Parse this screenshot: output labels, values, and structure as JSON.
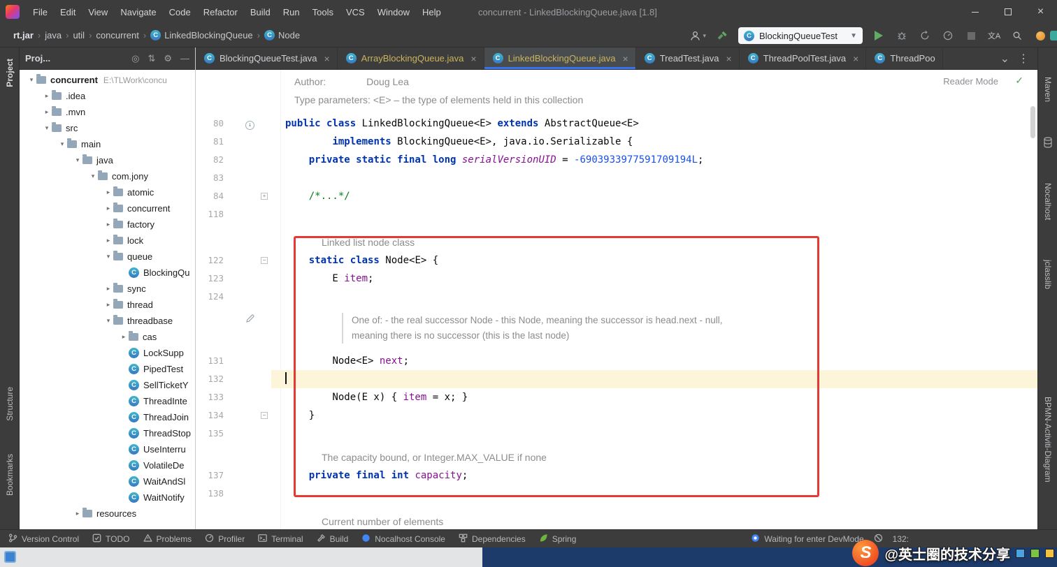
{
  "colors": {
    "accent_blue": "#3574f0",
    "annotation_red": "#e53935",
    "keyword_blue": "#0033b3",
    "field_purple": "#871094",
    "number_blue": "#1750eb",
    "watermark_orange": "#f04e23"
  },
  "window": {
    "title": "concurrent - LinkedBlockingQueue.java [1.8]"
  },
  "menu": [
    "File",
    "Edit",
    "View",
    "Navigate",
    "Code",
    "Refactor",
    "Build",
    "Run",
    "Tools",
    "VCS",
    "Window",
    "Help"
  ],
  "breadcrumbs": [
    {
      "label": "rt.jar"
    },
    {
      "label": "java"
    },
    {
      "label": "util"
    },
    {
      "label": "concurrent"
    },
    {
      "label": "LinkedBlockingQueue",
      "icon": "class"
    },
    {
      "label": "Node",
      "icon": "class"
    }
  ],
  "run_widget": {
    "config_name": "BlockingQueueTest"
  },
  "tabs": [
    {
      "label": "BlockingQueueTest.java",
      "lib": false,
      "active": false,
      "close": true
    },
    {
      "label": "ArrayBlockingQueue.java",
      "lib": true,
      "active": false,
      "close": true
    },
    {
      "label": "LinkedBlockingQueue.java",
      "lib": true,
      "active": true,
      "close": true
    },
    {
      "label": "TreadTest.java",
      "lib": false,
      "active": false,
      "close": true
    },
    {
      "label": "ThreadPoolTest.java",
      "lib": false,
      "active": false,
      "close": true
    },
    {
      "label": "ThreadPoo",
      "lib": false,
      "active": false,
      "close": false
    }
  ],
  "left_toolwindows": [
    "Project",
    "Structure",
    "Bookmarks"
  ],
  "right_toolwindows": [
    "Maven",
    "Nocalhost",
    "jclasslib",
    "BPMN-Activiti-Diagram"
  ],
  "project": {
    "header": "Proj..."
  },
  "tree": [
    {
      "label": "concurrent",
      "indent": 0,
      "chev": "v",
      "icon": "folder",
      "bold": true,
      "extra": "E:\\TLWork\\concu"
    },
    {
      "label": ".idea",
      "indent": 1,
      "chev": ">",
      "icon": "folder"
    },
    {
      "label": ".mvn",
      "indent": 1,
      "chev": ">",
      "icon": "folder"
    },
    {
      "label": "src",
      "indent": 1,
      "chev": "v",
      "icon": "folder"
    },
    {
      "label": "main",
      "indent": 2,
      "chev": "v",
      "icon": "folder"
    },
    {
      "label": "java",
      "indent": 3,
      "chev": "v",
      "icon": "folder"
    },
    {
      "label": "com.jony",
      "indent": 4,
      "chev": "v",
      "icon": "folder"
    },
    {
      "label": "atomic",
      "indent": 5,
      "chev": ">",
      "icon": "folder"
    },
    {
      "label": "concurrent",
      "indent": 5,
      "chev": ">",
      "icon": "folder"
    },
    {
      "label": "factory",
      "indent": 5,
      "chev": ">",
      "icon": "folder"
    },
    {
      "label": "lock",
      "indent": 5,
      "chev": ">",
      "icon": "folder"
    },
    {
      "label": "queue",
      "indent": 5,
      "chev": "v",
      "icon": "folder"
    },
    {
      "label": "BlockingQu",
      "indent": 6,
      "chev": "",
      "icon": "class"
    },
    {
      "label": "sync",
      "indent": 5,
      "chev": ">",
      "icon": "folder"
    },
    {
      "label": "thread",
      "indent": 5,
      "chev": ">",
      "icon": "folder"
    },
    {
      "label": "threadbase",
      "indent": 5,
      "chev": "v",
      "icon": "folder"
    },
    {
      "label": "cas",
      "indent": 6,
      "chev": ">",
      "icon": "folder"
    },
    {
      "label": "LockSupp",
      "indent": 6,
      "chev": "",
      "icon": "class"
    },
    {
      "label": "PipedTest",
      "indent": 6,
      "chev": "",
      "icon": "class"
    },
    {
      "label": "SellTicketY",
      "indent": 6,
      "chev": "",
      "icon": "class"
    },
    {
      "label": "ThreadInte",
      "indent": 6,
      "chev": "",
      "icon": "class"
    },
    {
      "label": "ThreadJoin",
      "indent": 6,
      "chev": "",
      "icon": "class"
    },
    {
      "label": "ThreadStop",
      "indent": 6,
      "chev": "",
      "icon": "class"
    },
    {
      "label": "UseInterru",
      "indent": 6,
      "chev": "",
      "icon": "class"
    },
    {
      "label": "VolatileDe",
      "indent": 6,
      "chev": "",
      "icon": "class"
    },
    {
      "label": "WaitAndSl",
      "indent": 6,
      "chev": "",
      "icon": "class"
    },
    {
      "label": "WaitNotify",
      "indent": 6,
      "chev": "",
      "icon": "class"
    },
    {
      "label": "resources",
      "indent": 3,
      "chev": ">",
      "icon": "folder"
    }
  ],
  "editor": {
    "reader_mode": "Reader Mode",
    "rows": [
      {
        "k": "d",
        "pad": 13,
        "segs": [
          {
            "t": "Author:",
            "c": "doc"
          },
          {
            "t": "Doug Lea",
            "c": "doc",
            "gap": 58
          }
        ]
      },
      {
        "k": "d",
        "pad": 13,
        "segs": [
          {
            "t": "Type parameters: <E> – the type of elements held in this collection",
            "c": "doc"
          }
        ]
      },
      {
        "k": "c",
        "n": "80",
        "mt": 8,
        "gicon": "override",
        "segs": [
          {
            "t": "public class ",
            "c": "kw"
          },
          {
            "t": "LinkedBlockingQueue<E> ",
            "c": "pl"
          },
          {
            "t": "extends ",
            "c": "kw"
          },
          {
            "t": "AbstractQueue<E>",
            "c": "pl"
          }
        ]
      },
      {
        "k": "c",
        "n": "81",
        "segs": [
          {
            "t": "        ",
            "c": "pl"
          },
          {
            "t": "implements ",
            "c": "kw"
          },
          {
            "t": "BlockingQueue<E>, java.io.Serializable {",
            "c": "pl"
          }
        ]
      },
      {
        "k": "c",
        "n": "82",
        "segs": [
          {
            "t": "    ",
            "c": "pl"
          },
          {
            "t": "private static final long ",
            "c": "kw"
          },
          {
            "t": "serialVersionUID ",
            "c": "sfld"
          },
          {
            "t": "= ",
            "c": "pl"
          },
          {
            "t": "-6903933977591709194L",
            "c": "nm"
          },
          {
            "t": ";",
            "c": "pl"
          }
        ]
      },
      {
        "k": "c",
        "n": "83",
        "segs": []
      },
      {
        "k": "c",
        "n": "84",
        "fold": "plus",
        "segs": [
          {
            "t": "    ",
            "c": "pl"
          },
          {
            "t": "/*...*/",
            "c": "cmt"
          }
        ]
      },
      {
        "k": "c",
        "n": "118",
        "segs": []
      },
      {
        "k": "d",
        "pad": 52,
        "mt": 14,
        "segs": [
          {
            "t": "Linked list node class",
            "c": "doc"
          }
        ]
      },
      {
        "k": "c",
        "n": "122",
        "fold": "minus",
        "segs": [
          {
            "t": "    ",
            "c": "pl"
          },
          {
            "t": "static class ",
            "c": "kw"
          },
          {
            "t": "Node<E> {",
            "c": "pl"
          }
        ]
      },
      {
        "k": "c",
        "n": "123",
        "segs": [
          {
            "t": "        E ",
            "c": "pl"
          },
          {
            "t": "item",
            "c": "fld"
          },
          {
            "t": ";",
            "c": "pl"
          }
        ]
      },
      {
        "k": "c",
        "n": "124",
        "segs": []
      },
      {
        "k": "d",
        "quote": true,
        "mt": 10,
        "gicon": "pencil",
        "segs": [
          {
            "t": "One of: - the real successor Node - this Node, meaning the successor is head.next - null,",
            "c": "doc"
          }
        ]
      },
      {
        "k": "d",
        "quote": true,
        "segs": [
          {
            "t": "meaning there is no successor (this is the last node)",
            "c": "doc"
          }
        ]
      },
      {
        "k": "c",
        "n": "131",
        "mt": 12,
        "segs": [
          {
            "t": "        ",
            "c": "pl"
          },
          {
            "t": "Node<E> ",
            "c": "pl"
          },
          {
            "t": "next",
            "c": "fld"
          },
          {
            "t": ";",
            "c": "pl"
          }
        ]
      },
      {
        "k": "c",
        "n": "132",
        "cur": true,
        "segs": []
      },
      {
        "k": "c",
        "n": "133",
        "segs": [
          {
            "t": "        Node(E x) { ",
            "c": "pl"
          },
          {
            "t": "item ",
            "c": "fld"
          },
          {
            "t": "= x; }",
            "c": "pl"
          }
        ]
      },
      {
        "k": "c",
        "n": "134",
        "fold": "minus",
        "segs": [
          {
            "t": "    }",
            "c": "pl"
          }
        ]
      },
      {
        "k": "c",
        "n": "135",
        "segs": []
      },
      {
        "k": "d",
        "pad": 52,
        "mt": 8,
        "segs": [
          {
            "t": "The capacity bound, or Integer.MAX_VALUE if none",
            "c": "doc"
          }
        ]
      },
      {
        "k": "c",
        "n": "137",
        "segs": [
          {
            "t": "    ",
            "c": "pl"
          },
          {
            "t": "private final int ",
            "c": "kw"
          },
          {
            "t": "capacity",
            "c": "fld"
          },
          {
            "t": ";",
            "c": "pl"
          }
        ]
      },
      {
        "k": "c",
        "n": "138",
        "segs": []
      },
      {
        "k": "d",
        "pad": 52,
        "mt": 14,
        "segs": [
          {
            "t": "Current number of elements",
            "c": "doc"
          }
        ]
      }
    ]
  },
  "status_left": [
    {
      "icon": "branch",
      "label": "Version Control"
    },
    {
      "icon": "todo",
      "label": "TODO"
    },
    {
      "icon": "problems",
      "label": "Problems"
    },
    {
      "icon": "profiler",
      "label": "Profiler"
    },
    {
      "icon": "terminal",
      "label": "Terminal"
    },
    {
      "icon": "build",
      "label": "Build"
    },
    {
      "icon": "nocalhost",
      "label": "Nocalhost Console"
    },
    {
      "icon": "deps",
      "label": "Dependencies"
    },
    {
      "icon": "spring",
      "label": "Spring"
    }
  ],
  "status_right": {
    "devmode_label": "Waiting for enter DevMode",
    "position_label": "132:"
  },
  "watermark": {
    "logo_letter": "S",
    "text": "@英士圈的技术分享"
  }
}
